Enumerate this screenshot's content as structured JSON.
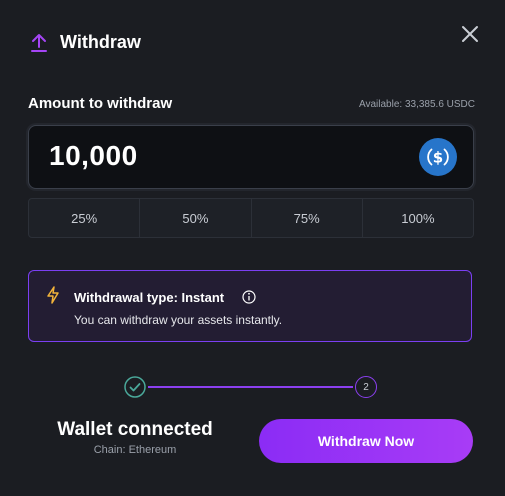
{
  "header": {
    "title": "Withdraw",
    "icon": "upload-arrow-icon"
  },
  "amount": {
    "label": "Amount to withdraw",
    "available": "Available: 33,385.6 USDC",
    "value": "10,000",
    "token_icon": "usdc-icon"
  },
  "percent_options": [
    "25%",
    "50%",
    "75%",
    "100%"
  ],
  "withdrawal_info": {
    "title": "Withdrawal type: Instant",
    "description": "You can withdraw your assets instantly.",
    "icon": "lightning-bolt-icon"
  },
  "steps": {
    "step1_state": "completed",
    "step2_label": "2"
  },
  "wallet": {
    "title": "Wallet connected",
    "chain": "Chain: Ethereum"
  },
  "actions": {
    "withdraw_label": "Withdraw Now"
  },
  "colors": {
    "accent": "#8b3ff0",
    "bolt": "#f2b33a",
    "usdc": "#2775ca",
    "step_done": "#4aa89a"
  }
}
